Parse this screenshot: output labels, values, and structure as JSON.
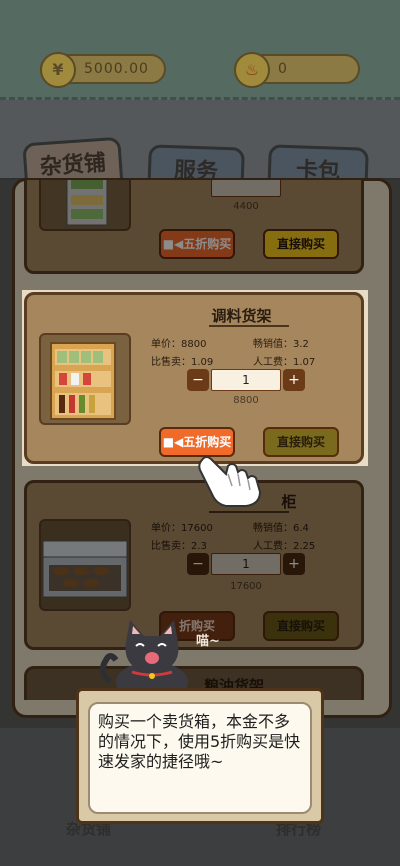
{
  "topbar": {
    "coins": {
      "icon": "coin-icon",
      "value": "5000.00"
    },
    "fire": {
      "icon": "fire-icon",
      "value": "0"
    }
  },
  "tabs": [
    {
      "label": "杂货铺",
      "active": true
    },
    {
      "label": "服务",
      "active": false
    },
    {
      "label": "卡包",
      "active": false
    }
  ],
  "cards": [
    {
      "name": "",
      "price": "4400",
      "half_label": "五折购买",
      "direct_label": "直接购买"
    },
    {
      "name": "调料货架",
      "stats": {
        "sales": "单价：8800",
        "attract": "畅销值：3.2",
        "cost_ratio": "比售卖：1.09",
        "labor": "人工费：1.07"
      },
      "quantity": "1",
      "price": "8800",
      "half_label": "五折购买",
      "direct_label": "直接购买"
    },
    {
      "name": "柜",
      "stats": {
        "sales": "单价：17600",
        "attract": "畅销值：6.4",
        "cost_ratio": "比售卖：2.3",
        "labor": "人工费：2.25"
      },
      "quantity": "1",
      "price": "17600",
      "half_label": "折购买",
      "direct_label": "直接购买"
    },
    {
      "name": "粮油货架"
    }
  ],
  "cat": {
    "speech": "喵~"
  },
  "dialog": {
    "text": "购买一个卖货箱，本金不多的情况下，使用5折购买是快速发家的捷径哦~"
  },
  "bottom_nav": {
    "left": "杂货铺",
    "right": "排行榜"
  },
  "colors": {
    "half_button": "#f06a2a",
    "direct_button": "#f4c81e",
    "card_bg": "#a5865d"
  }
}
